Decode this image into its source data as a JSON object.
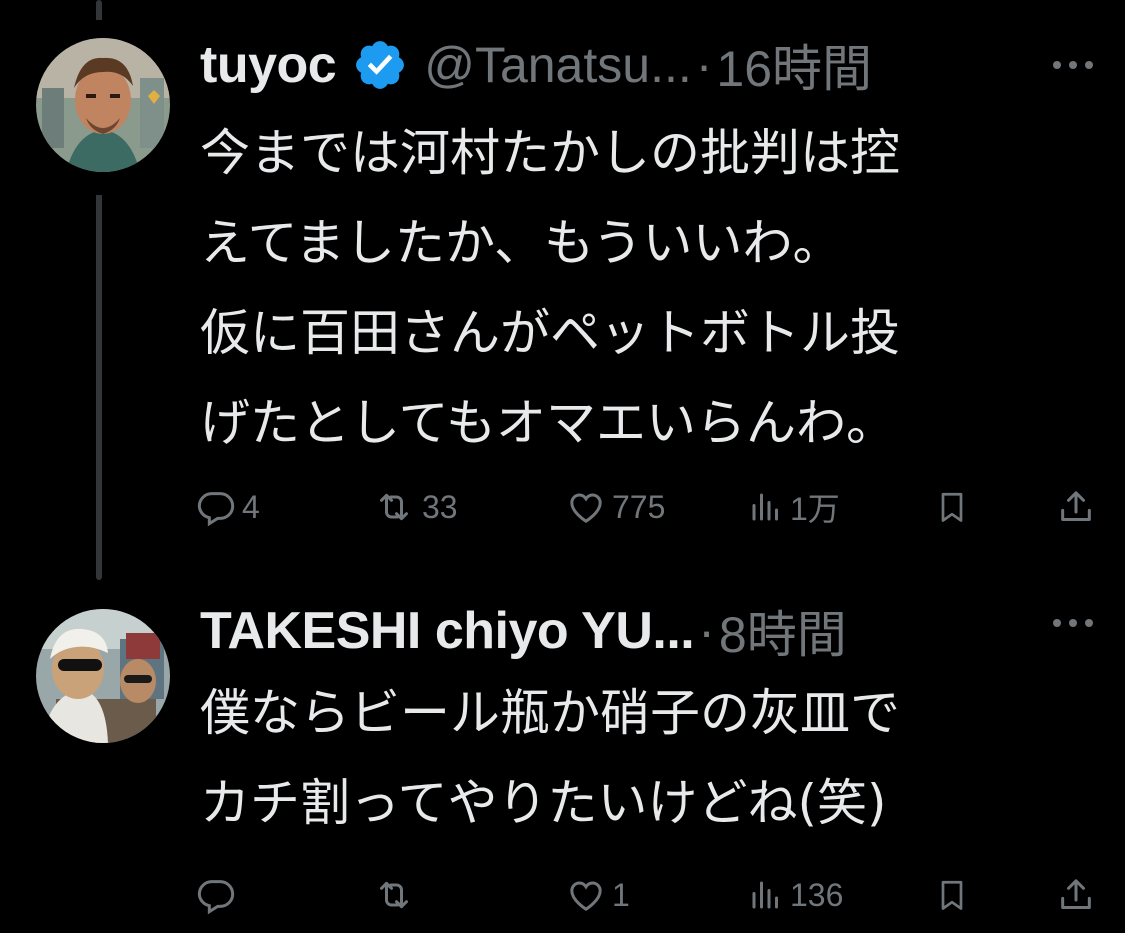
{
  "colors": {
    "background": "#000000",
    "text_primary": "#e7e9ea",
    "text_secondary": "#71767b",
    "verified_blue": "#1d9bf0",
    "thread_line": "#333639"
  },
  "tweets": [
    {
      "display_name": "tuyoc",
      "verified": true,
      "handle": "@Tanatsu...",
      "separator": "·",
      "time": "16時間",
      "text": "今までは河村たかしの批判は控\nえてましたか、もういいわ。\n仮に百田さんがペットボトル投\nげたとしてもオマエいらんわ。",
      "replies": "4",
      "reposts": "33",
      "likes": "775",
      "views": "1万",
      "icons": [
        "reply-icon",
        "repost-icon",
        "like-icon",
        "views-icon",
        "bookmark-icon",
        "share-icon"
      ]
    },
    {
      "display_name": "TAKESHI chiyo YU...",
      "verified": false,
      "handle": "",
      "separator": "·",
      "time": "8時間",
      "text": "僕ならビール瓶か硝子の灰皿で\nカチ割ってやりたいけどね(笑)",
      "replies": "",
      "reposts": "",
      "likes": "1",
      "views": "136",
      "icons": [
        "reply-icon",
        "repost-icon",
        "like-icon",
        "views-icon",
        "bookmark-icon",
        "share-icon"
      ]
    }
  ]
}
